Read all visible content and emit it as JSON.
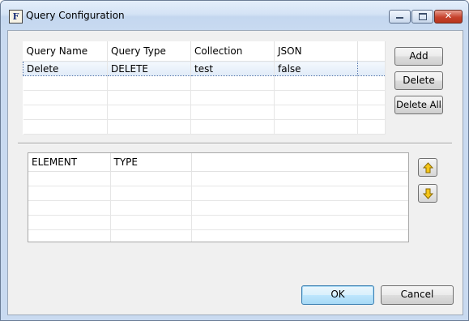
{
  "window": {
    "title": "Query Configuration",
    "icon_letter": "F",
    "controls": {
      "minimize": "minimize-icon",
      "maximize": "maximize-icon",
      "close": "close-icon"
    }
  },
  "queries_table": {
    "columns": [
      "Query Name",
      "Query Type",
      "Collection",
      "JSON"
    ],
    "rows": [
      {
        "name": "Delete",
        "type": "DELETE",
        "collection": "test",
        "json": "false"
      }
    ]
  },
  "query_buttons": {
    "add": "Add",
    "delete": "Delete",
    "delete_all": "Delete All"
  },
  "elements_table": {
    "columns": [
      "ELEMENT",
      "TYPE"
    ]
  },
  "move_buttons": {
    "up": "arrow-up-icon",
    "down": "arrow-down-icon"
  },
  "footer": {
    "ok": "OK",
    "cancel": "Cancel"
  },
  "colors": {
    "arrow_fill": "#f5c518",
    "arrow_stroke": "#8a6a00",
    "selection_border": "#4a6ea8"
  }
}
